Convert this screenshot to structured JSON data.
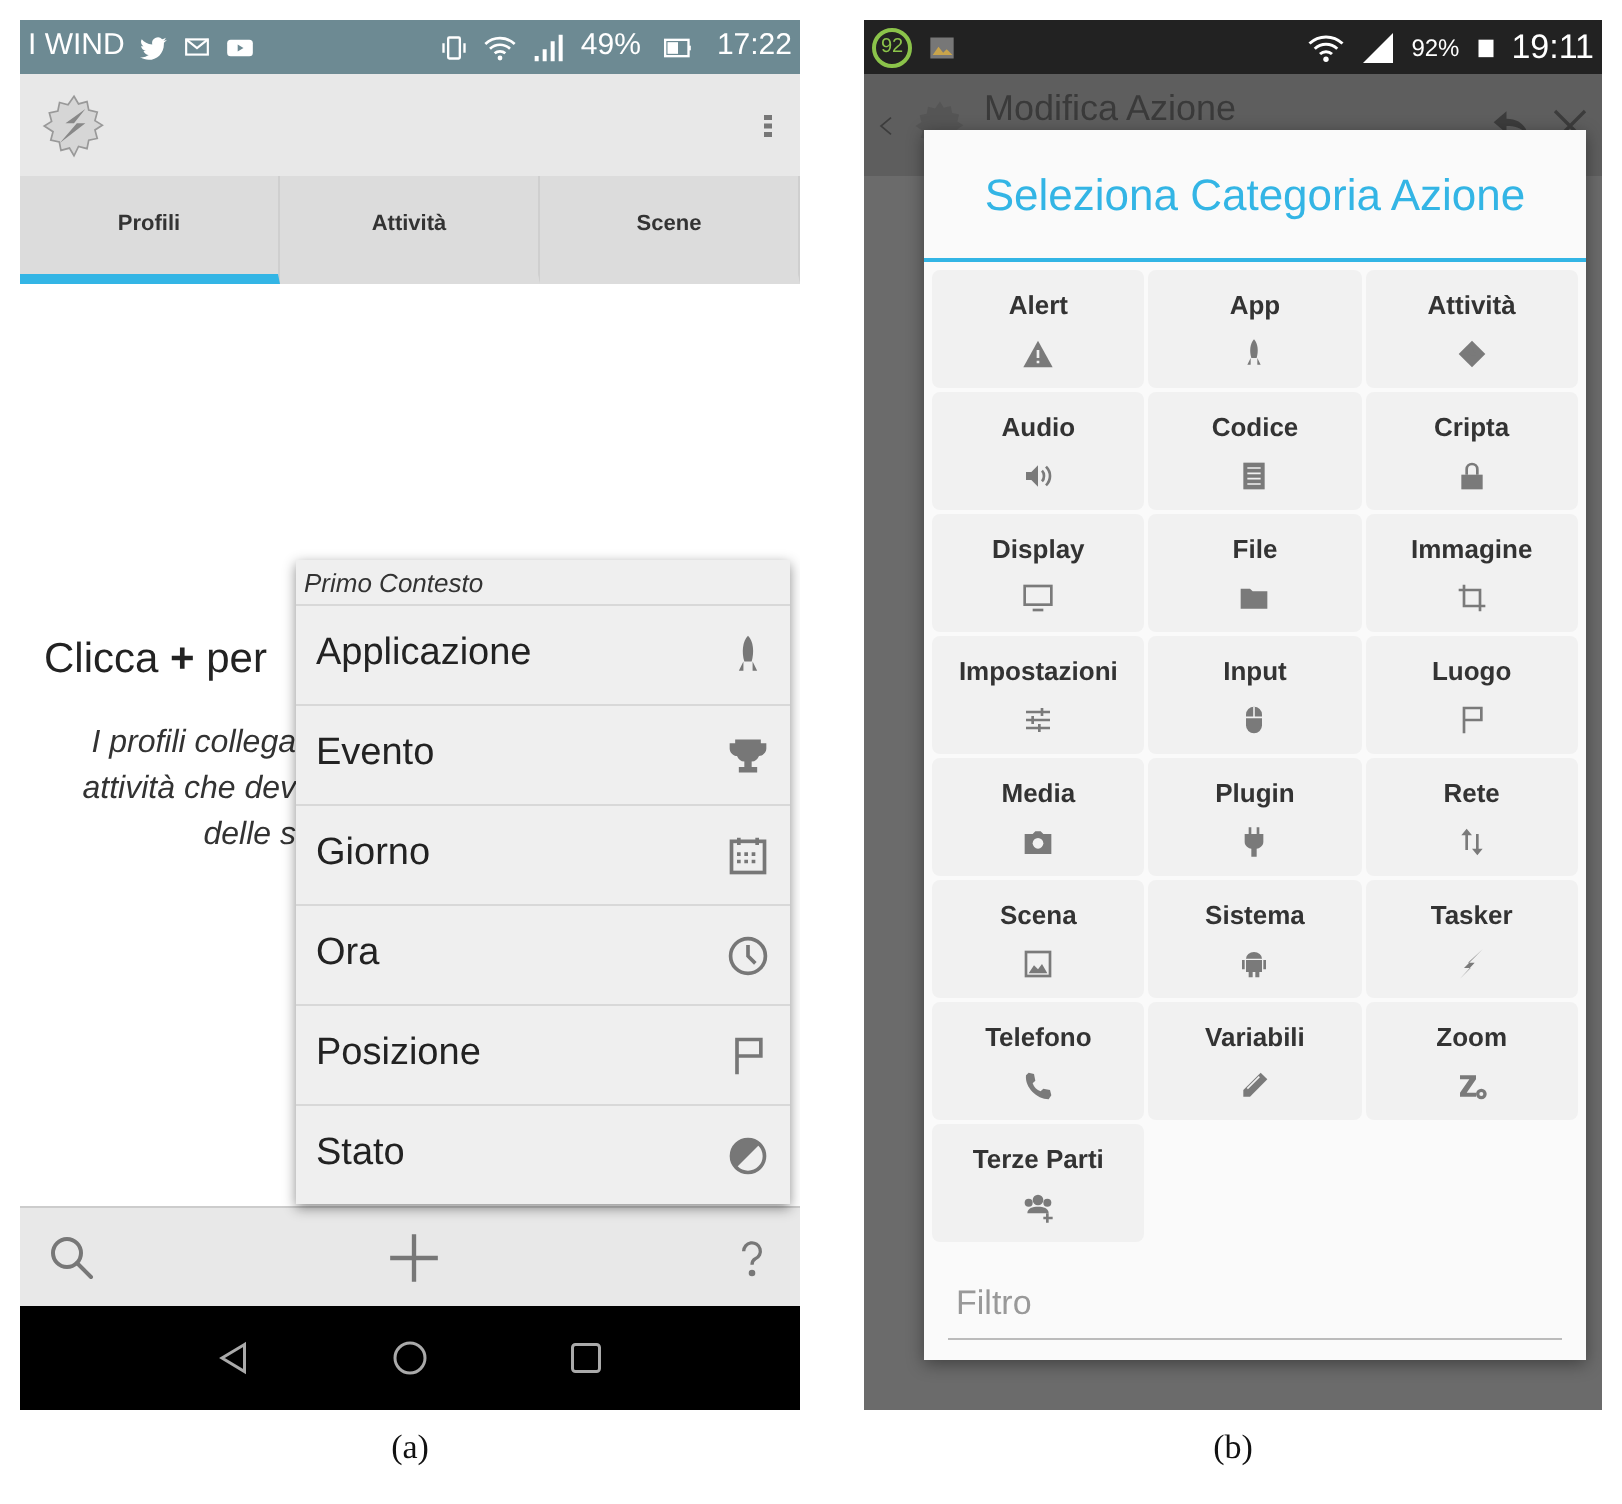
{
  "panel_a": {
    "caption": "(a)",
    "status_bar": {
      "carrier": "I WIND",
      "battery": "49%",
      "time": "17:22"
    },
    "tabs": [
      {
        "label": "Profili",
        "selected": true
      },
      {
        "label": "Attività",
        "selected": false
      },
      {
        "label": "Scene",
        "selected": false
      }
    ],
    "empty_state": {
      "heading": "Clicca **+** per",
      "hint_lines": [
        "I profili collega",
        "attività che dev",
        "delle s"
      ]
    },
    "context_menu": {
      "title": "Primo Contesto",
      "items": [
        "Applicazione",
        "Evento",
        "Giorno",
        "Ora",
        "Posizione",
        "Stato"
      ]
    }
  },
  "panel_b": {
    "caption": "(b)",
    "status_bar": {
      "badge": "92",
      "battery": "92%",
      "time": "19:11"
    },
    "app_bar": {
      "title": "Modifica Azione"
    },
    "dialog": {
      "title": "Seleziona Categoria Azione",
      "categories": [
        "Alert",
        "App",
        "Attività",
        "Audio",
        "Codice",
        "Cripta",
        "Display",
        "File",
        "Immagine",
        "Impostazioni",
        "Input",
        "Luogo",
        "Media",
        "Plugin",
        "Rete",
        "Scena",
        "Sistema",
        "Tasker",
        "Telefono",
        "Variabili",
        "Zoom",
        "Terze Parti"
      ],
      "filter": {
        "placeholder": "Filtro"
      }
    }
  }
}
